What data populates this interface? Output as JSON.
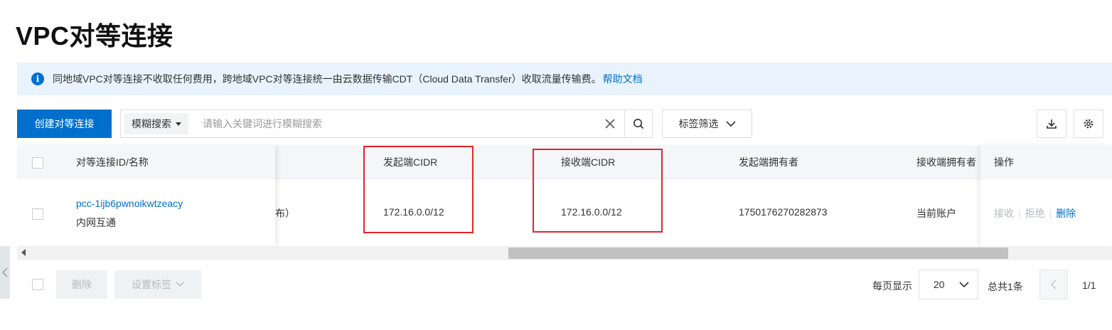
{
  "page": {
    "title": "VPC对等连接"
  },
  "notice": {
    "text": "同地域VPC对等连接不收取任何费用，跨地域VPC对等连接统一由云数据传输CDT（Cloud Data Transfer）收取流量传输费。",
    "link": "帮助文档",
    "icon": "info-icon"
  },
  "toolbar": {
    "create_label": "创建对等连接",
    "search_mode": "模糊搜索",
    "search_placeholder": "请输入关键词进行模糊搜索",
    "tag_filter_label": "标签筛选"
  },
  "table": {
    "columns": {
      "id_name": "对等连接ID/名称",
      "src_cidr": "发起端CIDR",
      "dst_cidr": "接收端CIDR",
      "src_owner": "发起端拥有者",
      "dst_owner": "接收端拥有者",
      "actions": "操作"
    },
    "rows": [
      {
        "id": "pcc-1ijb6pwnoikwtzeacy",
        "name": "内网互通",
        "partial_cell": "布）",
        "src_cidr": "172.16.0.0/12",
        "dst_cidr": "172.16.0.0/12",
        "src_owner": "1750176270282873",
        "dst_owner": "当前账户",
        "actions": [
          "接收",
          "拒绝",
          "删除"
        ]
      }
    ]
  },
  "footer": {
    "delete_label": "删除",
    "set_tags_label": "设置标签",
    "page_size_label": "每页显示",
    "page_size": "20",
    "total": "总共1条",
    "page_indicator": "1/1"
  },
  "colors": {
    "primary": "#0070cc",
    "highlight_box": "#e1252b",
    "notice_bg": "#e8f3fd"
  }
}
